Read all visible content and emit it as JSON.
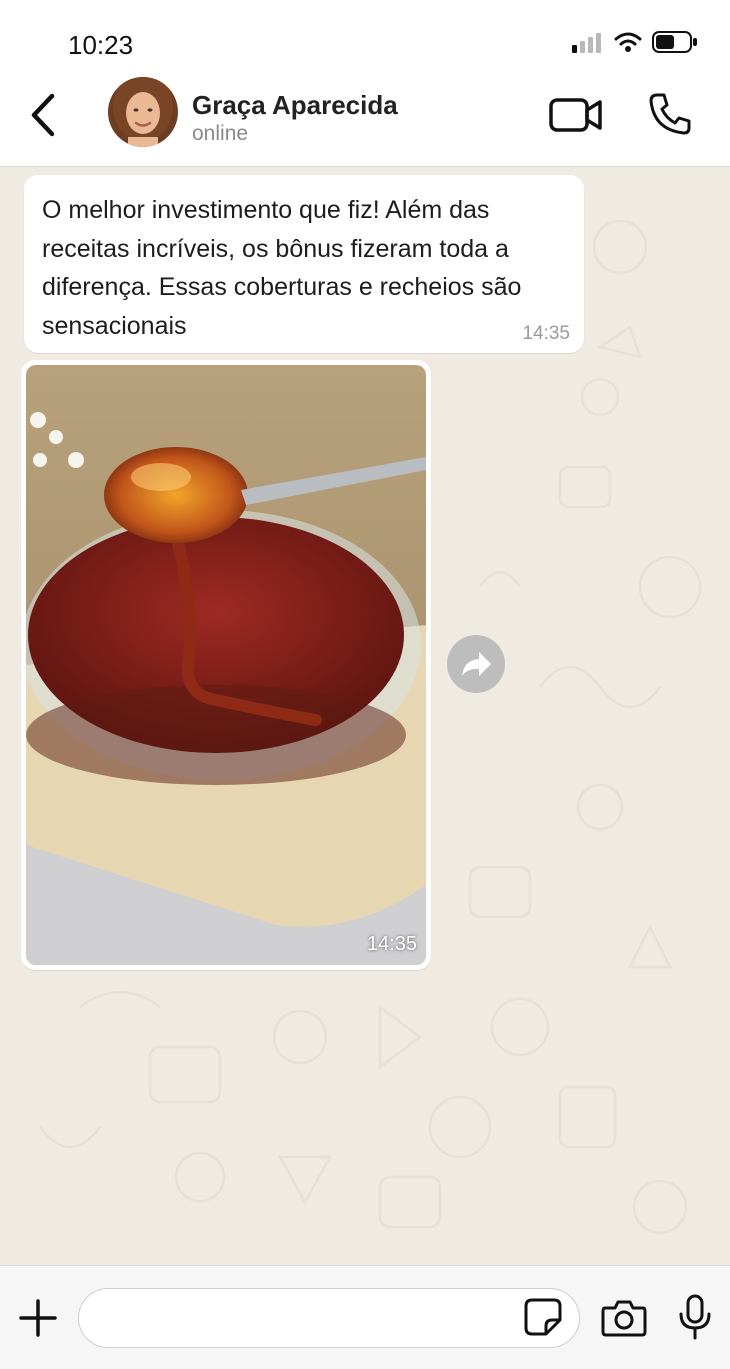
{
  "status_bar": {
    "time": "10:23",
    "icons": [
      "signal-icon",
      "wifi-icon",
      "battery-icon"
    ]
  },
  "header": {
    "contact_name": "Graça Aparecida",
    "contact_status": "online",
    "icons": [
      "back-chevron-icon",
      "video-camera-icon",
      "phone-icon"
    ]
  },
  "messages": [
    {
      "type": "text",
      "text": "O melhor investimento que fiz! Além das receitas incríveis, os bônus fizeram toda a diferença. Essas coberturas e recheios são sensacionais",
      "time": "14:35"
    },
    {
      "type": "image",
      "time": "14:35",
      "icon": "forward-arrow-icon"
    }
  ],
  "composer": {
    "placeholder": "",
    "icons": [
      "plus-icon",
      "sticker-icon",
      "camera-icon",
      "microphone-icon"
    ]
  },
  "colors": {
    "chat_background": "#efeae2",
    "bubble": "#ffffff",
    "timestamp": "#9a9a9a"
  }
}
